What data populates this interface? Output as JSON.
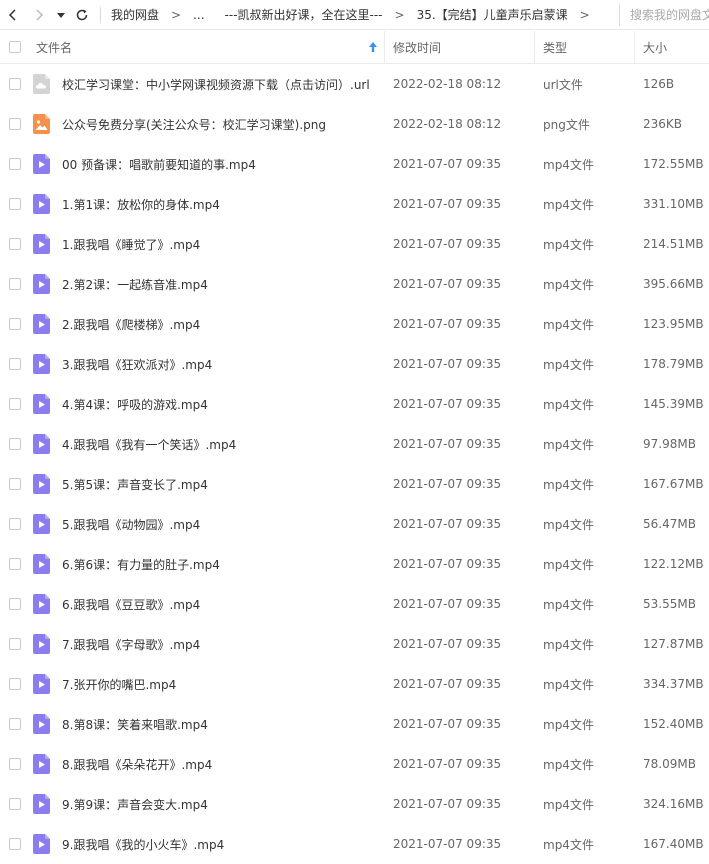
{
  "toolbar": {
    "breadcrumbs": [
      "我的网盘",
      "...",
      "---凯叔新出好课，全在这里---",
      "35.【完结】儿童声乐启蒙课"
    ],
    "search_placeholder": "搜索我的网盘文件"
  },
  "columns": {
    "name": "文件名",
    "time": "修改时间",
    "type": "类型",
    "size": "大小"
  },
  "colors": {
    "video_icon": "#8b7cf0",
    "image_icon": "#f5914d",
    "url_icon": "#d4d4d4",
    "sort_arrow": "#3b8ff0"
  },
  "files": [
    {
      "icon": "url-icon",
      "name": "校汇学习课堂：中小学网课视频资源下载（点击访问）.url",
      "time": "2022-02-18 08:12",
      "type": "url文件",
      "size": "126B"
    },
    {
      "icon": "image-icon",
      "name": "公众号免费分享(关注公众号：校汇学习课堂).png",
      "time": "2022-02-18 08:12",
      "type": "png文件",
      "size": "236KB"
    },
    {
      "icon": "video-icon",
      "name": "00 预备课：唱歌前要知道的事.mp4",
      "time": "2021-07-07 09:35",
      "type": "mp4文件",
      "size": "172.55MB"
    },
    {
      "icon": "video-icon",
      "name": "1.第1课：放松你的身体.mp4",
      "time": "2021-07-07 09:35",
      "type": "mp4文件",
      "size": "331.10MB"
    },
    {
      "icon": "video-icon",
      "name": "1.跟我唱《睡觉了》.mp4",
      "time": "2021-07-07 09:35",
      "type": "mp4文件",
      "size": "214.51MB"
    },
    {
      "icon": "video-icon",
      "name": "2.第2课：一起练音准.mp4",
      "time": "2021-07-07 09:35",
      "type": "mp4文件",
      "size": "395.66MB"
    },
    {
      "icon": "video-icon",
      "name": "2.跟我唱《爬楼梯》.mp4",
      "time": "2021-07-07 09:35",
      "type": "mp4文件",
      "size": "123.95MB"
    },
    {
      "icon": "video-icon",
      "name": "3.跟我唱《狂欢派对》.mp4",
      "time": "2021-07-07 09:35",
      "type": "mp4文件",
      "size": "178.79MB"
    },
    {
      "icon": "video-icon",
      "name": "4.第4课：呼吸的游戏.mp4",
      "time": "2021-07-07 09:35",
      "type": "mp4文件",
      "size": "145.39MB"
    },
    {
      "icon": "video-icon",
      "name": "4.跟我唱《我有一个笑话》.mp4",
      "time": "2021-07-07 09:35",
      "type": "mp4文件",
      "size": "97.98MB"
    },
    {
      "icon": "video-icon",
      "name": "5.第5课：声音变长了.mp4",
      "time": "2021-07-07 09:35",
      "type": "mp4文件",
      "size": "167.67MB"
    },
    {
      "icon": "video-icon",
      "name": "5.跟我唱《动物园》.mp4",
      "time": "2021-07-07 09:35",
      "type": "mp4文件",
      "size": "56.47MB"
    },
    {
      "icon": "video-icon",
      "name": "6.第6课：有力量的肚子.mp4",
      "time": "2021-07-07 09:35",
      "type": "mp4文件",
      "size": "122.12MB"
    },
    {
      "icon": "video-icon",
      "name": "6.跟我唱《豆豆歌》.mp4",
      "time": "2021-07-07 09:35",
      "type": "mp4文件",
      "size": "53.55MB"
    },
    {
      "icon": "video-icon",
      "name": "7.跟我唱《字母歌》.mp4",
      "time": "2021-07-07 09:35",
      "type": "mp4文件",
      "size": "127.87MB"
    },
    {
      "icon": "video-icon",
      "name": "7.张开你的嘴巴.mp4",
      "time": "2021-07-07 09:35",
      "type": "mp4文件",
      "size": "334.37MB"
    },
    {
      "icon": "video-icon",
      "name": "8.第8课：笑着来唱歌.mp4",
      "time": "2021-07-07 09:35",
      "type": "mp4文件",
      "size": "152.40MB"
    },
    {
      "icon": "video-icon",
      "name": "8.跟我唱《朵朵花开》.mp4",
      "time": "2021-07-07 09:35",
      "type": "mp4文件",
      "size": "78.09MB"
    },
    {
      "icon": "video-icon",
      "name": "9.第9课：声音会变大.mp4",
      "time": "2021-07-07 09:35",
      "type": "mp4文件",
      "size": "324.16MB"
    },
    {
      "icon": "video-icon",
      "name": "9.跟我唱《我的小火车》.mp4",
      "time": "2021-07-07 09:35",
      "type": "mp4文件",
      "size": "167.40MB"
    }
  ]
}
